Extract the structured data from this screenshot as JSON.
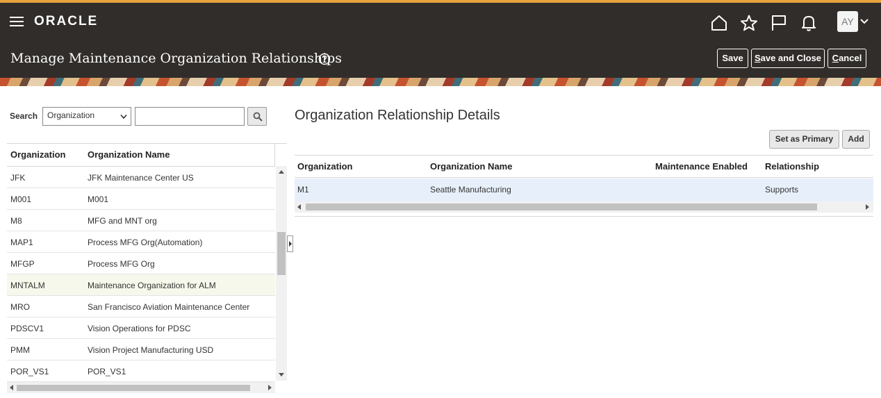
{
  "header": {
    "logo": "ORACLE",
    "title": "Manage Maintenance Organization Relationships",
    "icons": [
      "home-icon",
      "favorites-star-icon",
      "flag-icon",
      "notifications-bell-icon"
    ],
    "avatar_initials": "AY",
    "buttons": {
      "save": "Save",
      "save_close_first": "S",
      "save_close_rest": "ave and Close",
      "cancel_first": "C",
      "cancel_rest": "ancel"
    },
    "accent_color": "#e8a33d",
    "bg_color": "#312d2a"
  },
  "search": {
    "label": "Search",
    "select_value": "Organization",
    "input_value": ""
  },
  "left_table": {
    "columns": [
      "Organization",
      "Organization Name"
    ],
    "rows": [
      {
        "org": "JFK",
        "name": "JFK Maintenance Center US"
      },
      {
        "org": "M001",
        "name": "M001"
      },
      {
        "org": "M8",
        "name": "MFG and MNT org"
      },
      {
        "org": "MAP1",
        "name": "Process MFG Org(Automation)"
      },
      {
        "org": "MFGP",
        "name": "Process MFG Org"
      },
      {
        "org": "MNTALM",
        "name": "Maintenance Organization for ALM"
      },
      {
        "org": "MRO",
        "name": "San Francisco Aviation Maintenance Center"
      },
      {
        "org": "PDSCV1",
        "name": "Vision Operations for PDSC"
      },
      {
        "org": "PMM",
        "name": "Vision Project Manufacturing USD"
      },
      {
        "org": "POR_VS1",
        "name": "POR_VS1"
      }
    ],
    "selected_row": "MNTALM"
  },
  "details": {
    "title": "Organization Relationship Details",
    "buttons": {
      "set_primary": "Set as Primary",
      "add": "Add"
    },
    "columns": [
      "Organization",
      "Organization Name",
      "Maintenance Enabled",
      "Relationship"
    ],
    "rows": [
      {
        "org": "M1",
        "name": "Seattle Manufacturing",
        "maintenance_enabled": "",
        "relationship": "Supports"
      }
    ]
  }
}
